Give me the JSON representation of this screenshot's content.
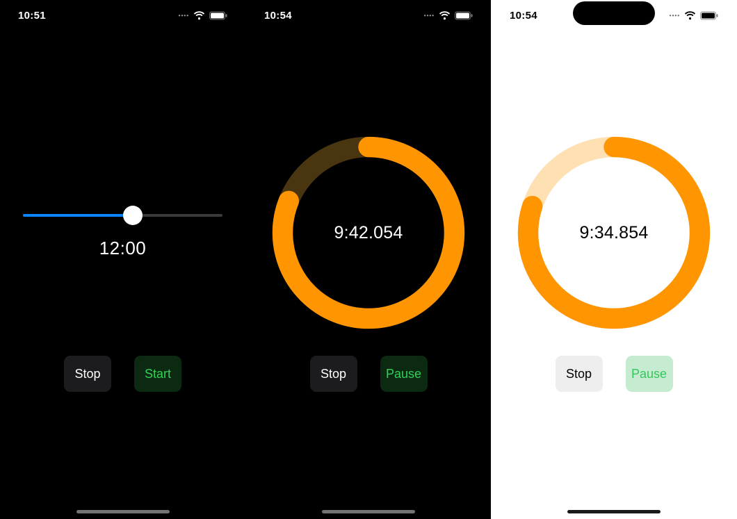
{
  "colors": {
    "orange": "#ff9500",
    "orange_track_dark": "#4a3511",
    "orange_track_light": "#ffe0b2",
    "blue": "#0a84ff",
    "green": "#30d158",
    "green_light": "#34c759"
  },
  "screens": [
    {
      "theme": "dark",
      "status": {
        "time": "10:51"
      },
      "mode": "slider",
      "slider": {
        "value_pct": 55,
        "label": "12:00"
      },
      "buttons": [
        {
          "key": "stop",
          "label": "Stop",
          "style": "btn-stop"
        },
        {
          "key": "start",
          "label": "Start",
          "style": "btn-start"
        }
      ]
    },
    {
      "theme": "dark",
      "status": {
        "time": "10:54"
      },
      "mode": "ring",
      "ring": {
        "progress": 0.81,
        "time_text": "9:42.054"
      },
      "buttons": [
        {
          "key": "stop",
          "label": "Stop",
          "style": "btn-stop"
        },
        {
          "key": "pause",
          "label": "Pause",
          "style": "btn-pause"
        }
      ]
    },
    {
      "theme": "light",
      "status": {
        "time": "10:54"
      },
      "has_island": true,
      "mode": "ring",
      "ring": {
        "progress": 0.8,
        "time_text": "9:34.854"
      },
      "buttons": [
        {
          "key": "stop",
          "label": "Stop",
          "style": "btn-stop"
        },
        {
          "key": "pause",
          "label": "Pause",
          "style": "btn-pause"
        }
      ]
    }
  ]
}
